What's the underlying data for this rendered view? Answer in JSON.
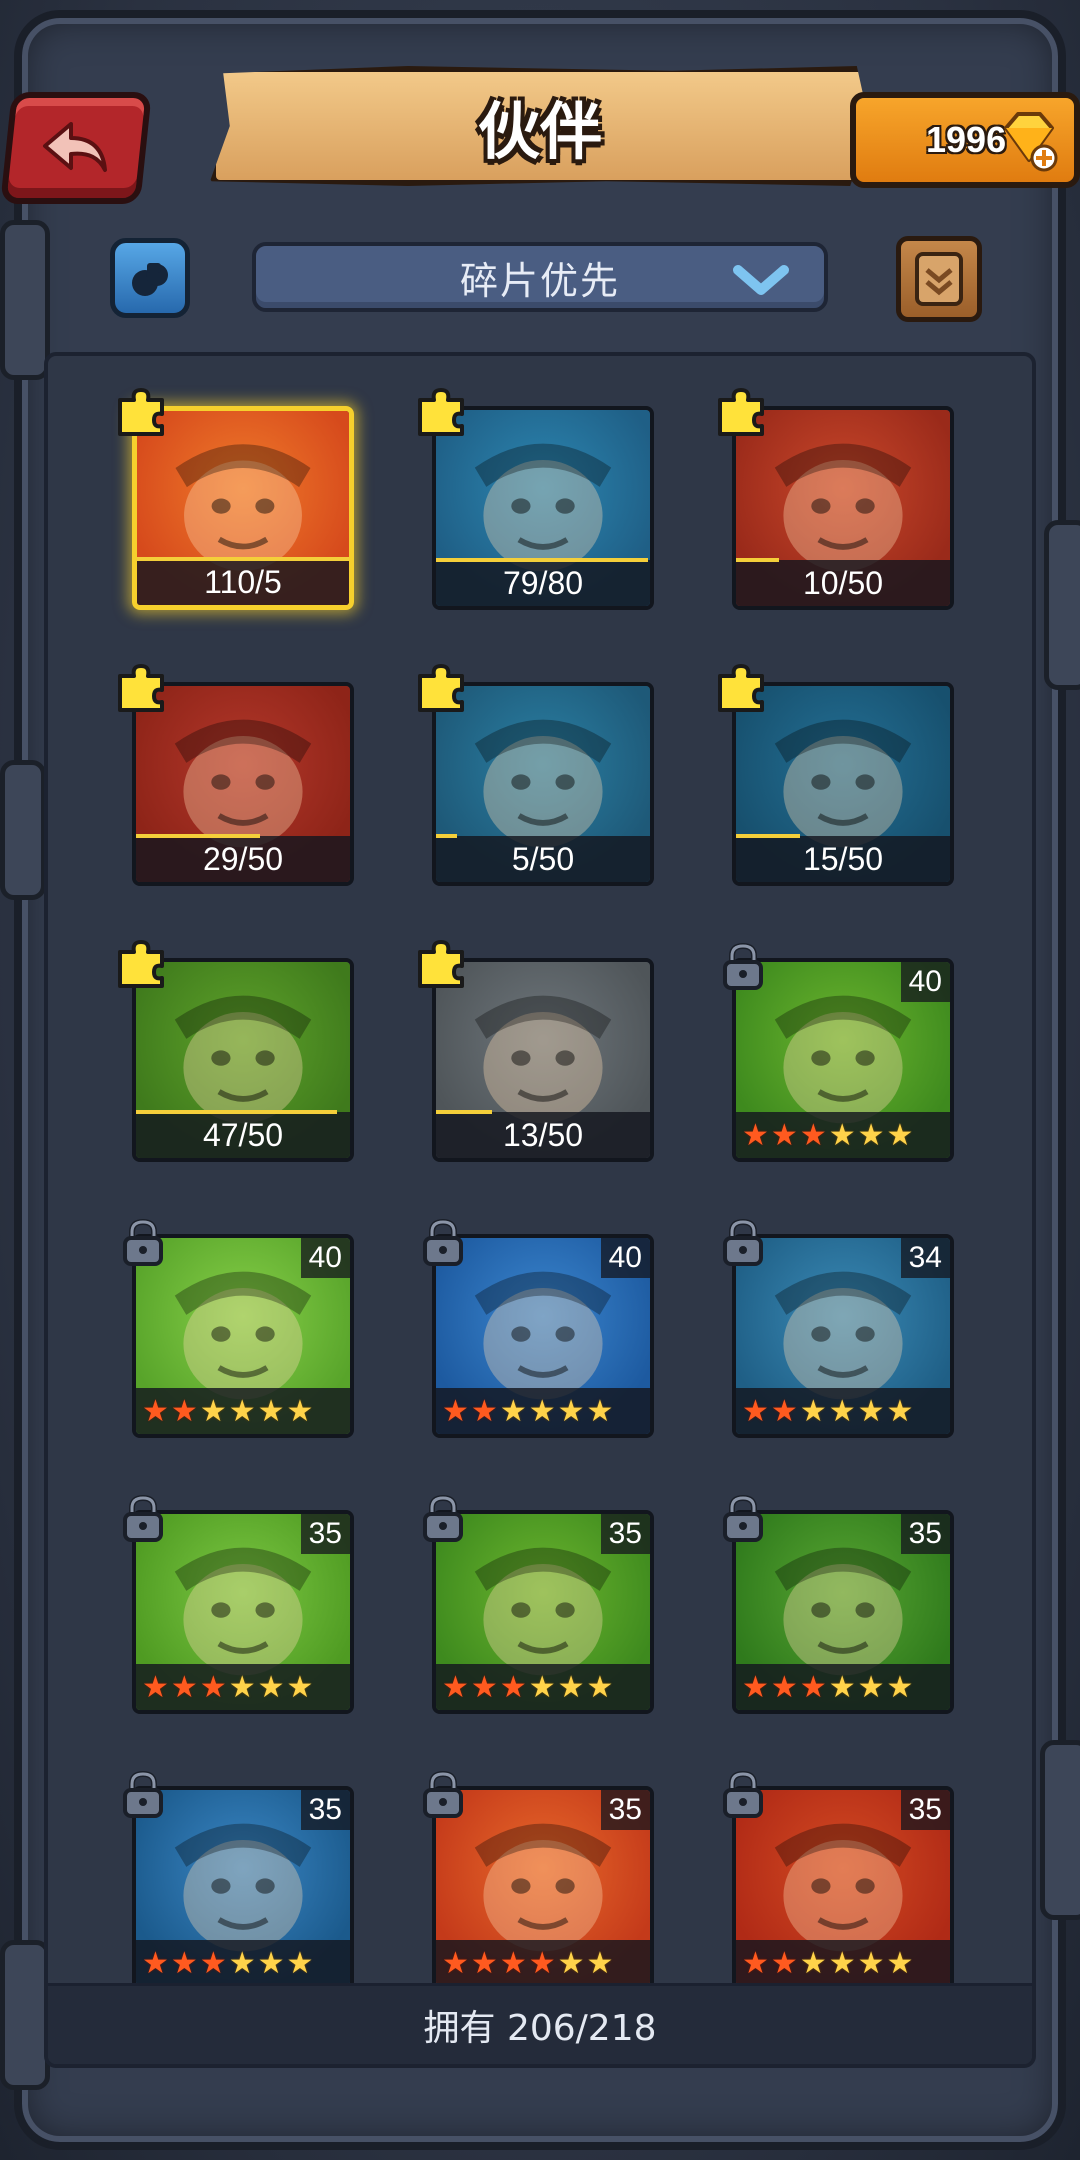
{
  "header": {
    "title": "伙伴",
    "gems": "1996"
  },
  "filter": {
    "sort_label": "碎片优先"
  },
  "footer": {
    "owned": "拥有 206/218"
  },
  "colors": {
    "accent_gold": "#f4cf3a",
    "star_filled": "#ff5a1f",
    "star_empty": "#ffd34a",
    "back_red": "#b3262a"
  },
  "heroes": [
    {
      "name": "crocodile-hero",
      "type": "fragment",
      "text": "110/5",
      "progress": 1.0,
      "bg": "#d64a1c",
      "bg2": "#f07a2a",
      "selected": true
    },
    {
      "name": "pirate-hero",
      "type": "fragment",
      "text": "79/80",
      "progress": 0.99,
      "bg": "#1f5f86",
      "bg2": "#2c86b1",
      "selected": false
    },
    {
      "name": "wolf-hero",
      "type": "fragment",
      "text": "10/50",
      "progress": 0.2,
      "bg": "#9a2a1a",
      "bg2": "#c9472a",
      "selected": false
    },
    {
      "name": "red-hair-girl-hero",
      "type": "fragment",
      "text": "29/50",
      "progress": 0.58,
      "bg": "#8e2418",
      "bg2": "#b3372a",
      "selected": false
    },
    {
      "name": "blue-wolf-hero",
      "type": "fragment",
      "text": "5/50",
      "progress": 0.1,
      "bg": "#1e5978",
      "bg2": "#2a7fa3",
      "selected": false
    },
    {
      "name": "dark-girl-hero",
      "type": "fragment",
      "text": "15/50",
      "progress": 0.3,
      "bg": "#17506e",
      "bg2": "#236f94",
      "selected": false
    },
    {
      "name": "green-girl-hero",
      "type": "fragment",
      "text": "47/50",
      "progress": 0.94,
      "bg": "#3f7a1c",
      "bg2": "#5ea22a",
      "selected": false
    },
    {
      "name": "shark-hero",
      "type": "fragment",
      "text": "13/50",
      "progress": 0.26,
      "bg": "#4f5559",
      "bg2": "#6e767b",
      "selected": false
    },
    {
      "name": "orc-boar-hero",
      "type": "locked",
      "level": "40",
      "stars": 3,
      "bg": "#3e8a1e",
      "bg2": "#6bb52e"
    },
    {
      "name": "frog-hero",
      "type": "locked",
      "level": "40",
      "stars": 2,
      "bg": "#58a42a",
      "bg2": "#86cf48"
    },
    {
      "name": "hooded-mage-hero",
      "type": "locked",
      "level": "40",
      "stars": 2,
      "bg": "#1d5aa0",
      "bg2": "#3b86cf"
    },
    {
      "name": "pirate-hero-2",
      "type": "locked",
      "level": "34",
      "stars": 2,
      "bg": "#1f5f86",
      "bg2": "#3a8ab6"
    },
    {
      "name": "scarecrow-hero",
      "type": "locked",
      "level": "35",
      "stars": 3,
      "bg": "#4f9b22",
      "bg2": "#7bc742"
    },
    {
      "name": "orc-boar-hero-2",
      "type": "locked",
      "level": "35",
      "stars": 3,
      "bg": "#3e8a1e",
      "bg2": "#6bb52e"
    },
    {
      "name": "dragon-hero",
      "type": "locked",
      "level": "35",
      "stars": 3,
      "bg": "#2f7a1c",
      "bg2": "#58a632"
    },
    {
      "name": "blue-warrior-hero",
      "type": "locked",
      "level": "35",
      "stars": 3,
      "bg": "#1b5a8c",
      "bg2": "#3a86c4"
    },
    {
      "name": "valkyrie-hero",
      "type": "locked",
      "level": "35",
      "stars": 4,
      "bg": "#c43a1a",
      "bg2": "#e8682a"
    },
    {
      "name": "barbarian-hero",
      "type": "locked",
      "level": "35",
      "stars": 2,
      "bg": "#b02a16",
      "bg2": "#d44a22"
    }
  ]
}
